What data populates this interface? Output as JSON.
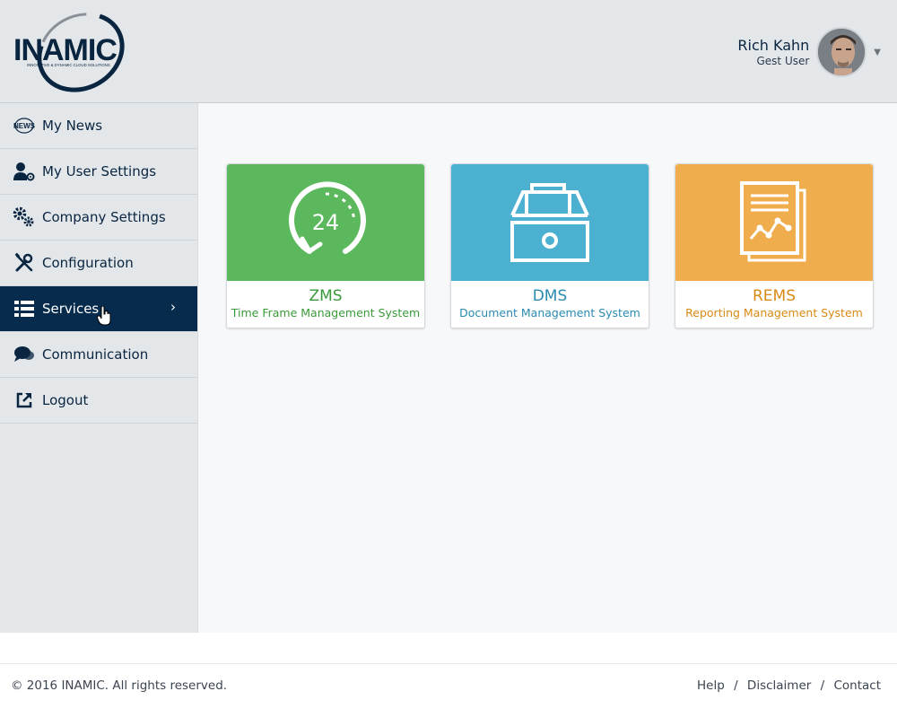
{
  "header": {
    "logo_text": "INAMIC",
    "logo_tagline": "INNOVATIVE & DYNAMIC CLOUD SOLUTIONS",
    "user_name": "Rich Kahn",
    "user_role": "Gest User"
  },
  "sidebar": {
    "items": [
      {
        "label": "My News",
        "icon": "news-icon"
      },
      {
        "label": "My User Settings",
        "icon": "user-settings-icon"
      },
      {
        "label": "Company Settings",
        "icon": "gears-icon"
      },
      {
        "label": "Configuration",
        "icon": "wrench-screwdriver-icon"
      },
      {
        "label": "Services",
        "icon": "list-icon",
        "active": true
      },
      {
        "label": "Communication",
        "icon": "chat-bubbles-icon"
      },
      {
        "label": "Logout",
        "icon": "external-link-icon"
      }
    ]
  },
  "cards": [
    {
      "title": "ZMS",
      "subtitle": "Time Frame Management System",
      "color": "#5cb85c",
      "text_color": "#3a9a3a",
      "icon": "24-hour-clock-icon",
      "icon_text": "24"
    },
    {
      "title": "DMS",
      "subtitle": "Document Management System",
      "color": "#4cb0d1",
      "text_color": "#2a8ab0",
      "icon": "document-drawer-icon"
    },
    {
      "title": "REMS",
      "subtitle": "Reporting Management System",
      "color": "#f0ad4e",
      "text_color": "#d98a14",
      "icon": "report-chart-icon"
    }
  ],
  "footer": {
    "copyright": "© 2016 INAMIC. All rights reserved.",
    "links": [
      "Help",
      "Disclaimer",
      "Contact"
    ],
    "separator": "/"
  }
}
